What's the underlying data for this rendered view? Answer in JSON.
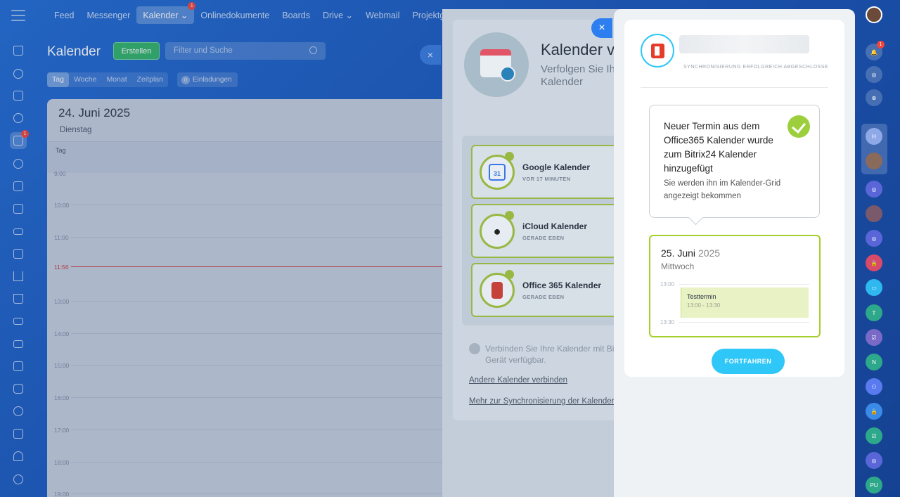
{
  "topnav": {
    "items": [
      "Feed",
      "Messenger",
      "Kalender",
      "Onlinedokumente",
      "Boards",
      "Drive",
      "Webmail",
      "Projektgruppen"
    ],
    "kalender_badge": "1"
  },
  "left_bar": {
    "calendar_badge": "1"
  },
  "calendar": {
    "title": "Kalender",
    "create_label": "Erstellen",
    "search_placeholder": "Filter und Suche",
    "tabs": [
      "Tag",
      "Woche",
      "Monat",
      "Zeitplan"
    ],
    "invites_count": "0",
    "invites_label": "Einladungen",
    "date": "24. Juni 2025",
    "weekday": "Dienstag",
    "day_label": "Tag",
    "hours": [
      "9:00",
      "10:00",
      "11:00",
      "13:00",
      "14:00",
      "15:00",
      "16:00",
      "17:00",
      "18:00",
      "19:00"
    ],
    "now_label": "11:56"
  },
  "sync_panel": {
    "title": "Kalender v",
    "subtitle_line1": "Verfolgen Sie Ih",
    "subtitle_line2": "Kalender",
    "providers": [
      {
        "name": "Google Kalender",
        "time": "VOR 17 MINUTEN"
      },
      {
        "name": "iCloud Kalender",
        "time": "GERADE EBEN"
      },
      {
        "name": "Office 365 Kalender",
        "time": "GERADE EBEN"
      }
    ],
    "note": "Verbinden Sie Ihre Kalender mit Bit jedem Gerät verfügbar.",
    "link_other": "Andere Kalender verbinden",
    "link_more": "Mehr zur Synchronisierung der Kalender",
    "close_label": "×"
  },
  "success_panel": {
    "sync_status": "SYNCHRONISIERUNG ERFOLGREICH ABGESCHLOSSE",
    "bubble_title": "Neuer Termin aus dem Office365 Kalender wurde zum Bitrix24 Kalender hinzugefügt",
    "bubble_desc": "Sie werden ihn im Kalender-Grid angezeigt bekommen",
    "event_day": "25. Juni",
    "event_year": "2025",
    "event_weekday": "Mittwoch",
    "time_start_label": "13:00",
    "time_end_label": "13:30",
    "event_name": "Testtermin",
    "event_time": "13:00 - 13:30",
    "continue_label": "FORTFAHREN"
  },
  "right_bar": {
    "notify_badge": "1",
    "avatars": [
      "H",
      "T",
      "N",
      "PU"
    ]
  },
  "colors": {
    "accent_blue": "#2fc7f7",
    "success_green": "#9dcf3d",
    "office_red": "#e53b2b"
  }
}
